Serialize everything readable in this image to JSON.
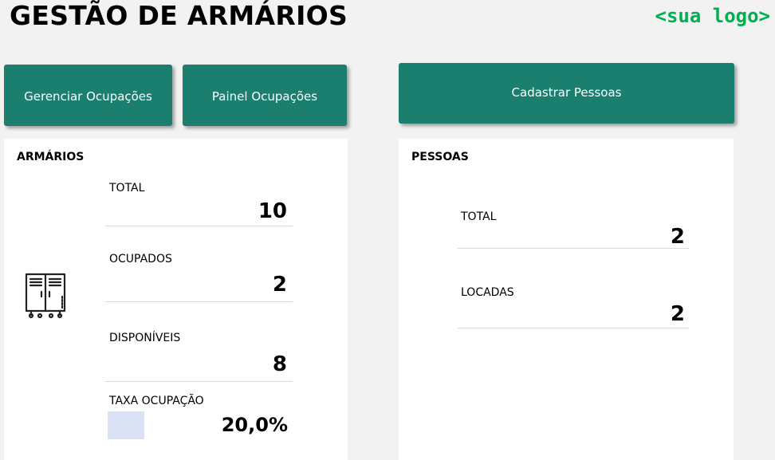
{
  "header": {
    "title": "GESTÃO DE ARMÁRIOS",
    "logo": "<sua logo>"
  },
  "buttons": {
    "gerenciar": "Gerenciar Ocupações",
    "painel": "Painel Ocupações",
    "cadastrar": "Cadastrar Pessoas"
  },
  "armarios": {
    "title": "ARMÁRIOS",
    "icon": "locker-icon",
    "total_label": "TOTAL",
    "total_value": "10",
    "ocupados_label": "OCUPADOS",
    "ocupados_value": "2",
    "disponiveis_label": "DISPONÍVEIS",
    "disponiveis_value": "8",
    "taxa_label": "TAXA OCUPAÇÃO",
    "taxa_value": "20,0%",
    "taxa_fraction": 0.2
  },
  "pessoas": {
    "title": "PESSOAS",
    "total_label": "TOTAL",
    "total_value": "2",
    "locadas_label": "LOCADAS",
    "locadas_value": "2"
  },
  "colors": {
    "button": "#1a7f6e",
    "logo": "#00b050",
    "rate_bar": "#d9e1f2"
  }
}
